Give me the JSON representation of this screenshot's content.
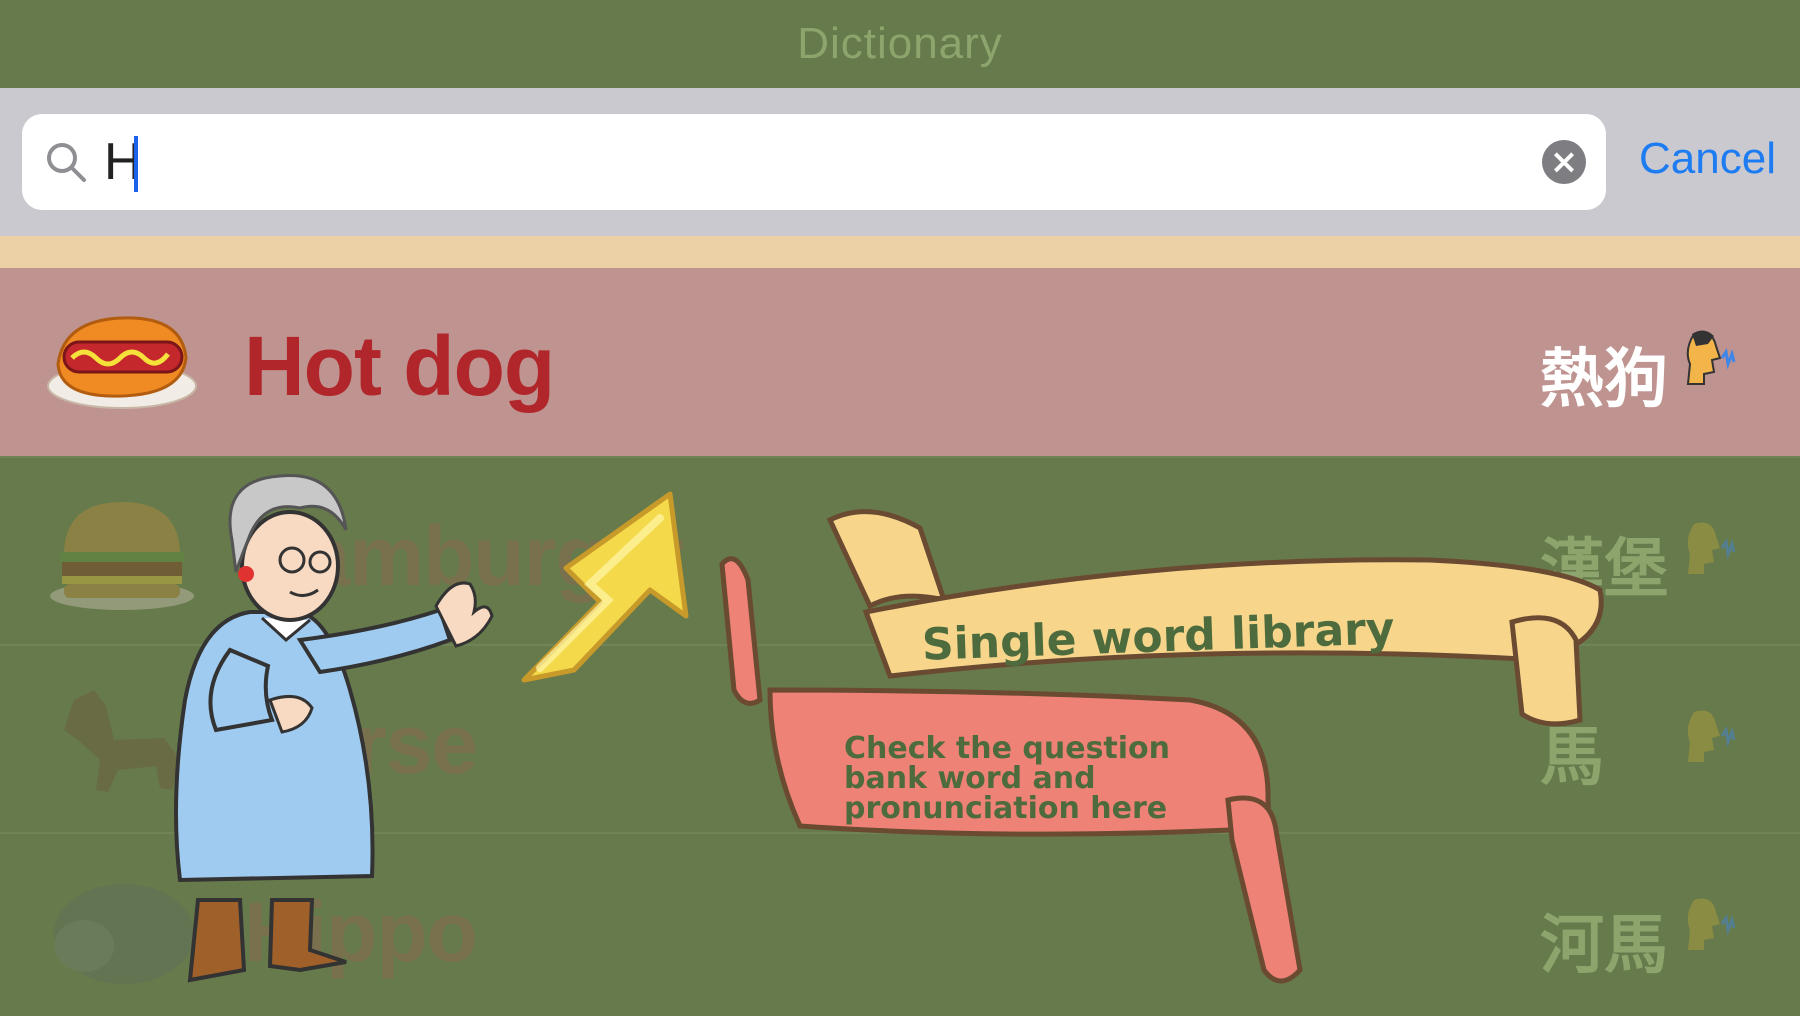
{
  "nav": {
    "title": "Dictionary"
  },
  "search": {
    "value": "H",
    "cancel_label": "Cancel"
  },
  "results": [
    {
      "word": "Hot dog",
      "chinese": "熱狗",
      "icon": "hotdog-icon"
    },
    {
      "word": "Hamburger",
      "chinese": "漢堡",
      "icon": "hamburger-icon"
    },
    {
      "word": "Horse",
      "chinese": "馬",
      "icon": "horse-icon"
    },
    {
      "word": "Hippo",
      "chinese": "河馬",
      "icon": "hippo-icon"
    }
  ],
  "banners": {
    "top": "Single word library",
    "bottom_line1": "Check the question",
    "bottom_line2": "bank word and",
    "bottom_line3": "pronunciation here"
  },
  "colors": {
    "nav_bg": "#667a4b",
    "highlight_row": "#bf9390",
    "word_highlight": "#b0262a",
    "accent_blue": "#1e7cf2",
    "banner_yellow": "#f7d68c",
    "banner_pink": "#ee8276",
    "banner_text": "#4d6b3d"
  }
}
